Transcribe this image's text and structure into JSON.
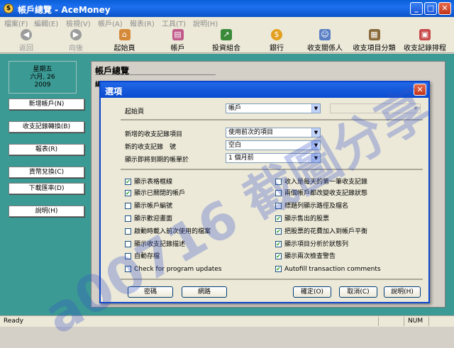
{
  "window": {
    "title": "帳戶總覽 - AceMoney",
    "icon": "app-logo-icon"
  },
  "menu": [
    {
      "label": "檔案(F)"
    },
    {
      "label": "編輯(E)"
    },
    {
      "label": "檢視(V)"
    },
    {
      "label": "帳戶(A)"
    },
    {
      "label": "報表(R)"
    },
    {
      "label": "工具(T)"
    },
    {
      "label": "說明(H)"
    }
  ],
  "toolbar": [
    {
      "label": "返回",
      "icon": "back-arrow-icon"
    },
    {
      "label": "向後",
      "icon": "forward-arrow-icon"
    },
    {
      "label": "起始頁",
      "icon": "home-icon"
    },
    {
      "label": "帳戶",
      "icon": "accounts-icon"
    },
    {
      "label": "投資組合",
      "icon": "investments-icon"
    },
    {
      "label": "銀行",
      "icon": "bank-icon"
    },
    {
      "label": "收支關係人",
      "icon": "payees-icon"
    },
    {
      "label": "收支項目分類",
      "icon": "categories-icon"
    },
    {
      "label": "收支記錄排程",
      "icon": "schedule-icon"
    }
  ],
  "sidebar": {
    "date": {
      "weekday": "星期五",
      "monthday": "六月, 26",
      "year": "2009"
    },
    "buttons": [
      {
        "label": "新增帳戶(N)"
      },
      {
        "label": "收支記錄轉換(B)"
      },
      {
        "label": "報表(R)"
      },
      {
        "label": "貨幣兌換(C)"
      },
      {
        "label": "下載匯率(D)"
      },
      {
        "label": "說明(H)"
      }
    ]
  },
  "panel": {
    "title": "帳戶總覽",
    "subtitle": "總計"
  },
  "dialog": {
    "title": "選項",
    "startup_label": "起始頁",
    "startup_value": "帳戶",
    "new_tx_label": "新增的收支記錄項目",
    "new_tx_value": "使用前次的項目",
    "new_tx_num_label": "新的收支記錄　號",
    "new_tx_num_value": "空白",
    "upcoming_label": "顯示即將到期的帳單於",
    "upcoming_value": "1 個月前",
    "left_checks": [
      {
        "label": "顯示表格框線",
        "checked": true
      },
      {
        "label": "顯示已關閉的帳戶",
        "checked": true
      },
      {
        "label": "顯示帳戶編號",
        "checked": false
      },
      {
        "label": "顯示歡迎畫面",
        "checked": false
      },
      {
        "label": "啟動時載入前次使用的檔案",
        "checked": false
      },
      {
        "label": "顯示收支記錄描述",
        "checked": false
      },
      {
        "label": "自動存檔",
        "checked": false
      },
      {
        "label": "Check for program updates",
        "checked": false
      }
    ],
    "right_checks": [
      {
        "label": "收入是每天的第一筆收支記錄",
        "checked": false
      },
      {
        "label": "兩個帳戶都改變收支記錄狀態",
        "checked": false
      },
      {
        "label": "標題列顯示路徑及檔名",
        "checked": false
      },
      {
        "label": "顯示售出的股票",
        "checked": true
      },
      {
        "label": "把股票的花費加入到帳戶平衡",
        "checked": true
      },
      {
        "label": "顯示項目分析於狀態列",
        "checked": true
      },
      {
        "label": "顯示兩次檢查警告",
        "checked": true
      },
      {
        "label": "Autofill transaction comments",
        "checked": true
      }
    ],
    "btn_password": "密碼",
    "btn_network": "網路",
    "btn_ok": "確定(O)",
    "btn_cancel": "取消(C)",
    "btn_help": "說明(H)"
  },
  "status": {
    "left": "Ready",
    "num": "NUM"
  },
  "watermark": "a00716 截圖分享"
}
